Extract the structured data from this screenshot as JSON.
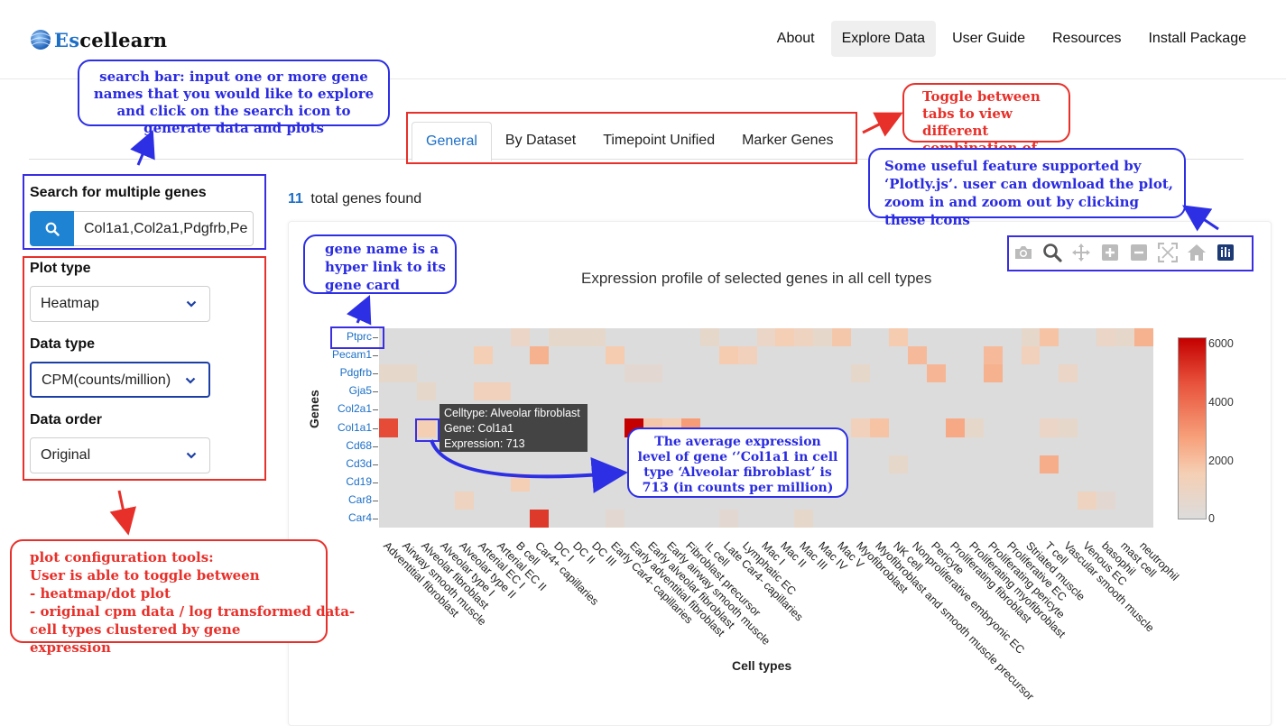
{
  "app": {
    "brand_prefix": "Es",
    "brand_rest": "cellearn"
  },
  "nav": [
    {
      "label": "About",
      "active": false
    },
    {
      "label": "Explore Data",
      "active": true
    },
    {
      "label": "User Guide",
      "active": false
    },
    {
      "label": "Resources",
      "active": false
    },
    {
      "label": "Install Package",
      "active": false
    }
  ],
  "tabs": [
    {
      "label": "General",
      "active": true
    },
    {
      "label": "By Dataset",
      "active": false
    },
    {
      "label": "Timepoint Unified",
      "active": false
    },
    {
      "label": "Marker Genes",
      "active": false
    }
  ],
  "sidebar": {
    "search_title": "Search for multiple genes",
    "search_value": "Col1a1,Col2a1,Pdgfrb,Pe",
    "plot_type_label": "Plot type",
    "plot_type_value": "Heatmap",
    "data_type_label": "Data type",
    "data_type_value": "CPM(counts/million)",
    "data_order_label": "Data order",
    "data_order_value": "Original"
  },
  "results": {
    "count": "11",
    "count_text": "total genes found"
  },
  "modebar_icons": [
    "camera-icon",
    "zoom-icon",
    "pan-icon",
    "zoom-in-icon",
    "zoom-out-icon",
    "autoscale-icon",
    "reset-axes-icon",
    "plotly-logo-icon"
  ],
  "annotations": {
    "search": "search bar: input one or more gene names that you would like to explore and click on the search icon to generate data and plots",
    "tabs": "Toggle between tabs to view different combination of plots",
    "plotly": "Some useful feature supported by ‘Plotly.js’. user can download the plot, zoom in and zoom out by clicking these icons",
    "gene_link": "gene name is a hyper link to its gene card",
    "expression": "The average expression level of gene ‘’Col1a1 in cell type ‘Alveolar fibroblast’ is 713 (in counts per million)",
    "config_title": "plot configuration tools:",
    "config_line1": "User is able to toggle between",
    "config_line2": "- heatmap/dot plot",
    "config_line3": "- original cpm data / log transformed data-",
    "config_line4": "cell types clustered by gene expression"
  },
  "tooltip": {
    "line1": "Celltype: Alveolar fibroblast",
    "line2": "Gene: Col1a1",
    "line3": "Expression: 713"
  },
  "colors": {
    "accent": "#1c6fc7",
    "annotation_red": "#e8302a",
    "annotation_blue": "#2d2fe4",
    "heat_max": "#c40000",
    "heat_zero": "#dcdcdc"
  },
  "chart_data": {
    "type": "heatmap",
    "title": "Expression profile of selected genes in all cell types",
    "xlabel": "Cell types",
    "ylabel": "Genes",
    "genes": [
      "Ptprc",
      "Pecam1",
      "Pdgfrb",
      "Gja5",
      "Col2a1",
      "Col1a1",
      "Cd68",
      "Cd3d",
      "Cd19",
      "Car8",
      "Car4"
    ],
    "cell_types": [
      "Adventitial fibroblast",
      "Airway smooth muscle",
      "Alveolar fibroblast",
      "Alveolar type I",
      "Alveolar type II",
      "Arterial EC I",
      "Arterial EC II",
      "B cell",
      "Car4+ capillaries",
      "DC I",
      "DC II",
      "DC III",
      "Early Car4- capillaries",
      "Early adventitial fibroblast",
      "Early alveolar fibroblast",
      "Early airway smooth muscle",
      "Fibroblast precursor",
      "IL cell",
      "Late Car4- capillaries",
      "Lymphatic EC",
      "Mac I",
      "Mac II",
      "Mac III",
      "Mac IV",
      "Mac V",
      "Myofibroblast",
      "Myofibroblast and smooth muscle precursor",
      "NK cell",
      "Nonproliferative embryonic EC",
      "Pericyte",
      "Proliferating fibroblast",
      "Proliferating myofibroblast",
      "Proliferating pericyte",
      "Proliferative EC",
      "Striated muscle",
      "T cell",
      "Vascular smooth muscle",
      "Venous EC",
      "basophil",
      "mast cell",
      "neutrophil"
    ],
    "colorbar": {
      "ticks": [
        "6000",
        "4000",
        "2000",
        "0"
      ],
      "range": [
        0,
        6000
      ]
    },
    "values": [
      [
        0,
        0,
        0,
        0,
        0,
        0,
        0,
        400,
        0,
        300,
        300,
        300,
        0,
        0,
        0,
        0,
        0,
        300,
        0,
        0,
        400,
        700,
        500,
        300,
        900,
        0,
        0,
        800,
        0,
        0,
        0,
        0,
        0,
        0,
        300,
        1000,
        0,
        0,
        400,
        300,
        1400
      ],
      [
        0,
        0,
        0,
        0,
        0,
        700,
        0,
        0,
        1400,
        0,
        0,
        0,
        800,
        0,
        0,
        0,
        0,
        0,
        800,
        600,
        0,
        0,
        0,
        0,
        0,
        0,
        0,
        0,
        1200,
        0,
        0,
        0,
        1200,
        0,
        600,
        0,
        0,
        0,
        0,
        0,
        0
      ],
      [
        300,
        300,
        0,
        0,
        0,
        0,
        0,
        0,
        0,
        0,
        0,
        0,
        0,
        200,
        200,
        0,
        0,
        0,
        0,
        0,
        0,
        0,
        0,
        0,
        0,
        300,
        0,
        0,
        0,
        1300,
        0,
        0,
        1400,
        0,
        0,
        0,
        400,
        0,
        0,
        0,
        0
      ],
      [
        0,
        0,
        300,
        0,
        0,
        600,
        600,
        0,
        0,
        0,
        0,
        0,
        0,
        0,
        0,
        0,
        0,
        0,
        0,
        0,
        0,
        0,
        0,
        0,
        0,
        0,
        0,
        0,
        0,
        0,
        0,
        0,
        0,
        0,
        0,
        0,
        0,
        0,
        0,
        0,
        0
      ],
      [
        0,
        0,
        0,
        0,
        0,
        0,
        0,
        0,
        0,
        0,
        0,
        0,
        0,
        0,
        0,
        0,
        0,
        0,
        0,
        0,
        0,
        0,
        0,
        0,
        0,
        0,
        0,
        0,
        0,
        0,
        0,
        0,
        0,
        0,
        0,
        0,
        0,
        0,
        0,
        0,
        0
      ],
      [
        3800,
        0,
        713,
        0,
        0,
        0,
        0,
        0,
        0,
        0,
        0,
        0,
        0,
        6000,
        900,
        700,
        1900,
        0,
        0,
        0,
        0,
        0,
        0,
        0,
        0,
        600,
        1000,
        0,
        0,
        0,
        1600,
        300,
        0,
        0,
        0,
        400,
        300,
        0,
        0,
        0,
        0
      ],
      [
        0,
        0,
        0,
        0,
        0,
        0,
        0,
        0,
        0,
        0,
        0,
        0,
        0,
        0,
        0,
        0,
        0,
        0,
        0,
        0,
        0,
        0,
        0,
        0,
        0,
        0,
        0,
        0,
        0,
        0,
        0,
        0,
        0,
        0,
        0,
        0,
        0,
        0,
        0,
        0,
        0
      ],
      [
        0,
        0,
        0,
        0,
        0,
        0,
        0,
        0,
        0,
        0,
        0,
        0,
        0,
        0,
        0,
        0,
        0,
        0,
        0,
        0,
        0,
        0,
        0,
        0,
        0,
        0,
        0,
        300,
        0,
        0,
        0,
        0,
        0,
        0,
        0,
        1500,
        0,
        0,
        0,
        0,
        0
      ],
      [
        0,
        0,
        0,
        0,
        0,
        0,
        0,
        700,
        0,
        0,
        0,
        0,
        0,
        0,
        0,
        0,
        0,
        0,
        0,
        0,
        0,
        0,
        0,
        0,
        0,
        0,
        0,
        0,
        0,
        0,
        0,
        0,
        0,
        0,
        0,
        0,
        0,
        0,
        0,
        0,
        0
      ],
      [
        0,
        0,
        0,
        0,
        500,
        0,
        0,
        0,
        0,
        0,
        0,
        0,
        0,
        0,
        0,
        0,
        0,
        0,
        0,
        0,
        0,
        0,
        0,
        0,
        0,
        0,
        0,
        0,
        0,
        0,
        0,
        0,
        0,
        0,
        0,
        0,
        0,
        500,
        200,
        0,
        0
      ],
      [
        0,
        0,
        0,
        0,
        0,
        0,
        0,
        0,
        4300,
        0,
        0,
        0,
        200,
        0,
        0,
        0,
        0,
        0,
        200,
        0,
        0,
        0,
        300,
        0,
        0,
        0,
        0,
        0,
        0,
        0,
        0,
        0,
        0,
        0,
        0,
        0,
        0,
        0,
        0,
        0,
        0
      ]
    ]
  }
}
